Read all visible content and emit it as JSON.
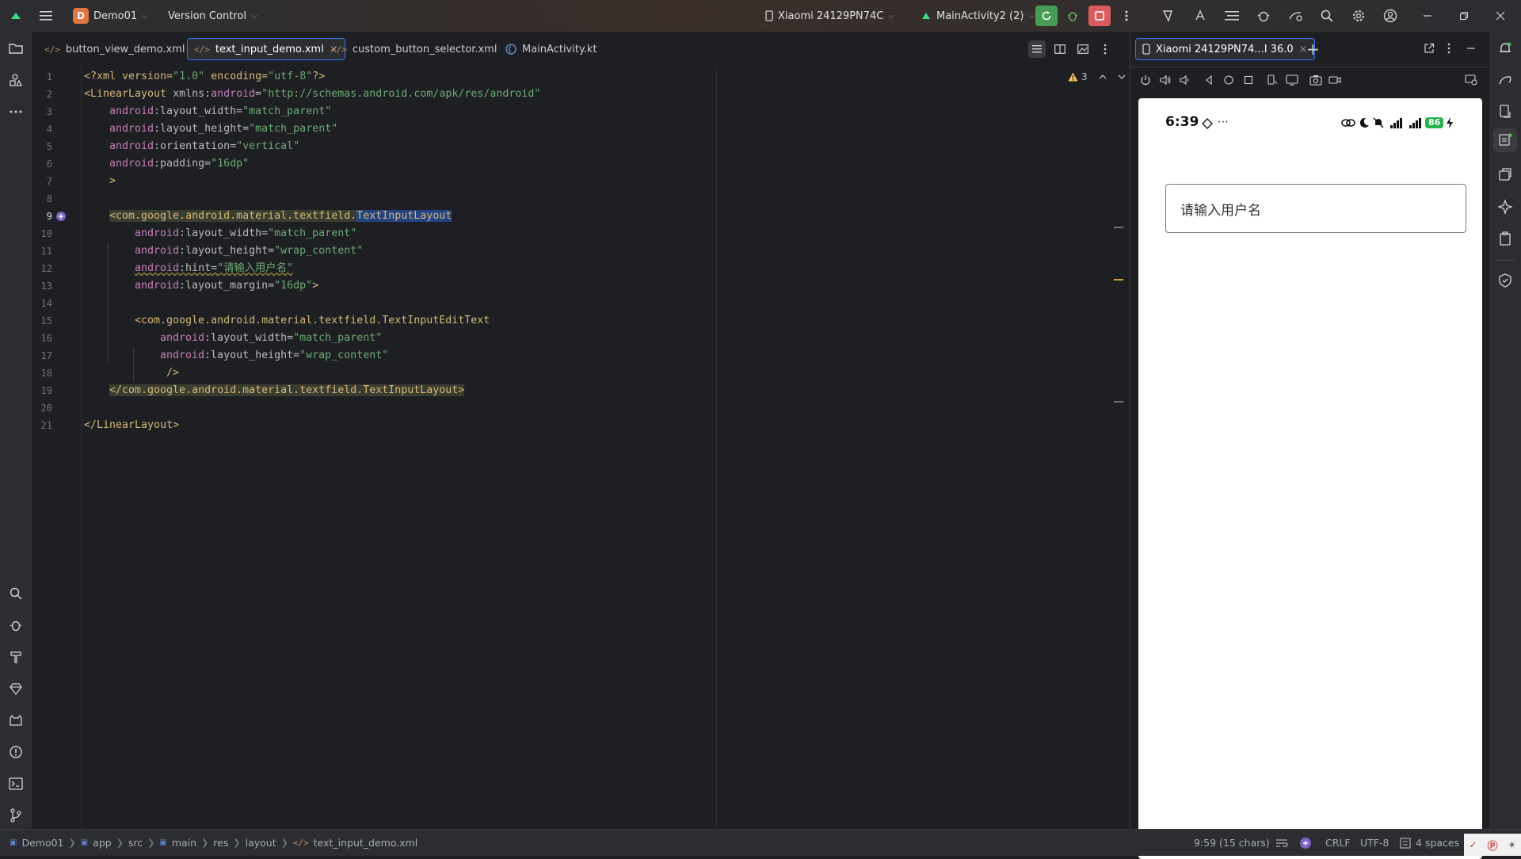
{
  "titlebar": {
    "project_badge": "D",
    "project": "Demo01",
    "vcs": "Version Control",
    "device": "Xiaomi 24129PN74C",
    "run_config": "MainActivity2 (2)"
  },
  "tabs": [
    {
      "label": "button_view_demo.xml"
    },
    {
      "label": "text_input_demo.xml",
      "close": "×"
    },
    {
      "label": "custom_button_selector.xml"
    },
    {
      "label": "MainActivity.kt"
    }
  ],
  "editor": {
    "warnings": "3",
    "line_numbers": [
      "1",
      "2",
      "3",
      "4",
      "5",
      "6",
      "7",
      "8",
      "9",
      "10",
      "11",
      "12",
      "13",
      "14",
      "15",
      "16",
      "17",
      "18",
      "19",
      "20",
      "21"
    ],
    "lines": {
      "l1": {
        "p1": "<?xml version=",
        "s1": "\"1.0\"",
        "p2": " encoding=",
        "s2": "\"utf-8\"",
        "p3": "?>"
      },
      "l2": {
        "t": "<LinearLayout ",
        "a": "xmlns:",
        "ns": "android",
        "eq": "=",
        "s": "\"http://schemas.android.com/apk/res/android\""
      },
      "l3": {
        "ns": "android",
        "a": ":layout_width",
        "eq": "=",
        "s": "\"match_parent\""
      },
      "l4": {
        "ns": "android",
        "a": ":layout_height",
        "eq": "=",
        "s": "\"match_parent\""
      },
      "l5": {
        "ns": "android",
        "a": ":orientation",
        "eq": "=",
        "s": "\"vertical\""
      },
      "l6": {
        "ns": "android",
        "a": ":padding",
        "eq": "=",
        "s": "\"16dp\""
      },
      "l7": {
        "t": ">"
      },
      "l9": {
        "t1": "<com.google.android.material.textfield.",
        "t2": "TextInputLayout"
      },
      "l10": {
        "ns": "android",
        "a": ":layout_width",
        "eq": "=",
        "s": "\"match_parent\""
      },
      "l11": {
        "ns": "android",
        "a": ":layout_height",
        "eq": "=",
        "s": "\"wrap_content\""
      },
      "l12": {
        "ns": "android",
        "a": ":hint",
        "eq": "=",
        "s": "\"请输入用户名\""
      },
      "l13": {
        "ns": "android",
        "a": ":layout_margin",
        "eq": "=",
        "s": "\"16dp\"",
        "t": ">"
      },
      "l15": {
        "t": "<com.google.android.material.textfield.TextInputEditText"
      },
      "l16": {
        "ns": "android",
        "a": ":layout_width",
        "eq": "=",
        "s": "\"match_parent\""
      },
      "l17": {
        "ns": "android",
        "a": ":layout_height",
        "eq": "=",
        "s": "\"wrap_content\""
      },
      "l18": {
        "t": "/>"
      },
      "l19": {
        "t": "</com.google.android.material.textfield.TextInputLayout>"
      },
      "l21": {
        "t": "</LinearLayout>"
      }
    }
  },
  "device_panel": {
    "tab_label": "Xiaomi 24129PN74...I 36.0",
    "tab_close": "×",
    "add": "+",
    "phone": {
      "time": "6:39",
      "battery": "86",
      "hint": "请输入用户名"
    }
  },
  "statusbar": {
    "breadcrumbs": [
      "Demo01",
      "app",
      "src",
      "main",
      "res",
      "layout",
      "text_input_demo.xml"
    ],
    "position": "9:59 (15 chars)",
    "line_sep": "CRLF",
    "encoding": "UTF-8",
    "indent": "4 spaces"
  },
  "colors": {
    "accent": "#3574f0",
    "selection": "#214283",
    "tag": "#d5b778",
    "string": "#6aab73",
    "namespace": "#c77dbb",
    "run_green": "#499c54",
    "stop_red": "#db5c5c"
  }
}
